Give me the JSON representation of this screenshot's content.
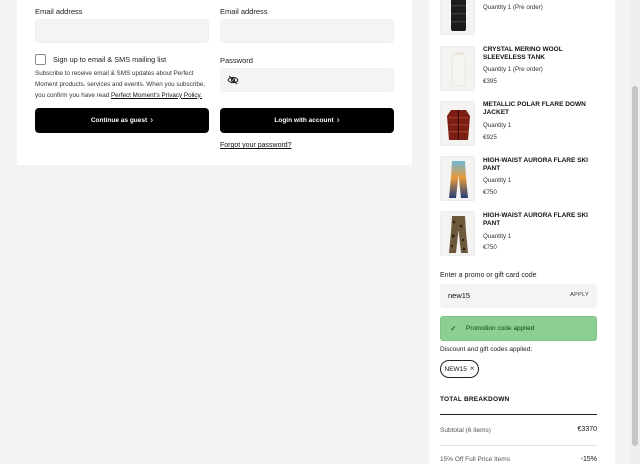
{
  "guest": {
    "email_label": "Email address",
    "email_value": "",
    "signup_label": "Sign up to email & SMS mailing list",
    "consent_text": "Subscribe to receive email & SMS updates about Perfect Moment products, services and events. When you subscribe, you confirm you have read",
    "privacy_link": "Perfect Moment's Privacy Policy.",
    "continue_label": "Continue as guest"
  },
  "login": {
    "email_label": "Email address",
    "email_value": "",
    "password_label": "Password",
    "password_value": "",
    "login_label": "Login with account",
    "forgot_label": "Forgot your password?"
  },
  "cart": {
    "items": [
      {
        "name": "",
        "qty": "Quantity 1 (Pre order)",
        "price": ""
      },
      {
        "name": "CRYSTAL MERINO WOOL SLEEVELESS TANK",
        "qty": "Quantity 1 (Pre order)",
        "price": "€395"
      },
      {
        "name": "METALLIC POLAR FLARE DOWN JACKET",
        "qty": "Quantity 1",
        "price": "€925"
      },
      {
        "name": "HIGH-WAIST AURORA FLARE SKI PANT",
        "qty": "Quantity 1",
        "price": "€750"
      },
      {
        "name": "HIGH-WAIST AURORA FLARE SKI PANT",
        "qty": "Quantity 1",
        "price": "€750"
      }
    ],
    "promo_label": "Enter a promo or gift card code",
    "promo_value": "new15",
    "apply_label": "APPLY",
    "success_message": "Promotion code applied",
    "discount_label": "Discount and gift codes applied:",
    "applied_code": "NEW15",
    "breakdown_title": "TOTAL BREAKDOWN",
    "subtotal_label": "Subtotal (6 items)",
    "subtotal_value": "€3370",
    "discount_row_label": "15% Off Full Price Items",
    "discount_row_value": "-15%"
  },
  "colors": {
    "success_bg": "#8ccf93",
    "button_bg": "#000000",
    "page_bg": "#f3f3f3"
  }
}
